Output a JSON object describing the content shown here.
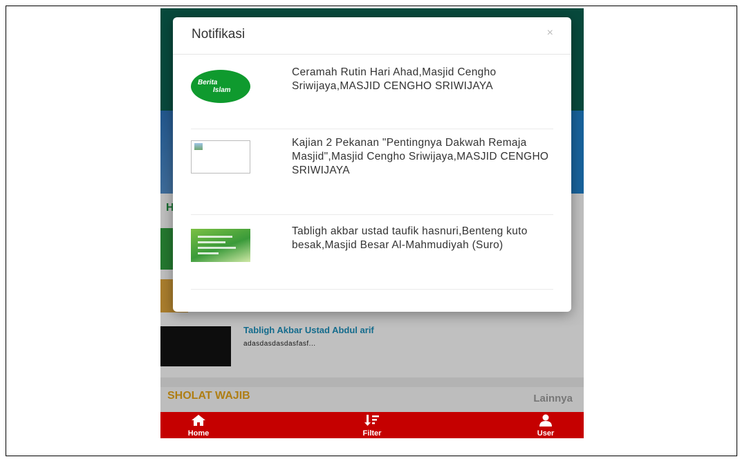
{
  "background_app": {
    "section_heading": "H",
    "news": {
      "title": "Tabligh Akbar Ustad Abdul arif",
      "excerpt": "adasdasdasdasfasf..."
    },
    "sholat_section": {
      "title": "SHOLAT WAJIB",
      "more_label": "Lainnya"
    },
    "bottom_nav": [
      {
        "label": "Home",
        "icon": "home-icon"
      },
      {
        "label": "Filter",
        "icon": "filter-icon"
      },
      {
        "label": "User",
        "icon": "user-icon"
      }
    ]
  },
  "modal": {
    "title": "Notifikasi",
    "close_glyph": "×",
    "items": [
      {
        "thumbnail": "berita-islam-logo",
        "logo_text_1": "Berita",
        "logo_text_2": "Islam",
        "text": "Ceramah Rutin Hari Ahad,Masjid Cengho Sriwijaya,MASJID CENGHO SRIWIJAYA"
      },
      {
        "thumbnail": "broken-image",
        "text": "Kajian 2 Pekanan \"Pentingnya Dakwah Remaja Masjid\",Masjid Cengho Sriwijaya,MASJID CENGHO SRIWIJAYA"
      },
      {
        "thumbnail": "event-poster",
        "text": "Tabligh akbar ustad taufik hasnuri,Benteng kuto besak,Masjid Besar Al-Mahmudiyah (Suro)"
      }
    ]
  },
  "colors": {
    "header_teal": "#0b5e4d",
    "nav_red": "#c50000",
    "badge_green": "#0f9a2e",
    "sholat_orange": "#e0a21a",
    "news_title_blue": "#1a8ab4"
  }
}
